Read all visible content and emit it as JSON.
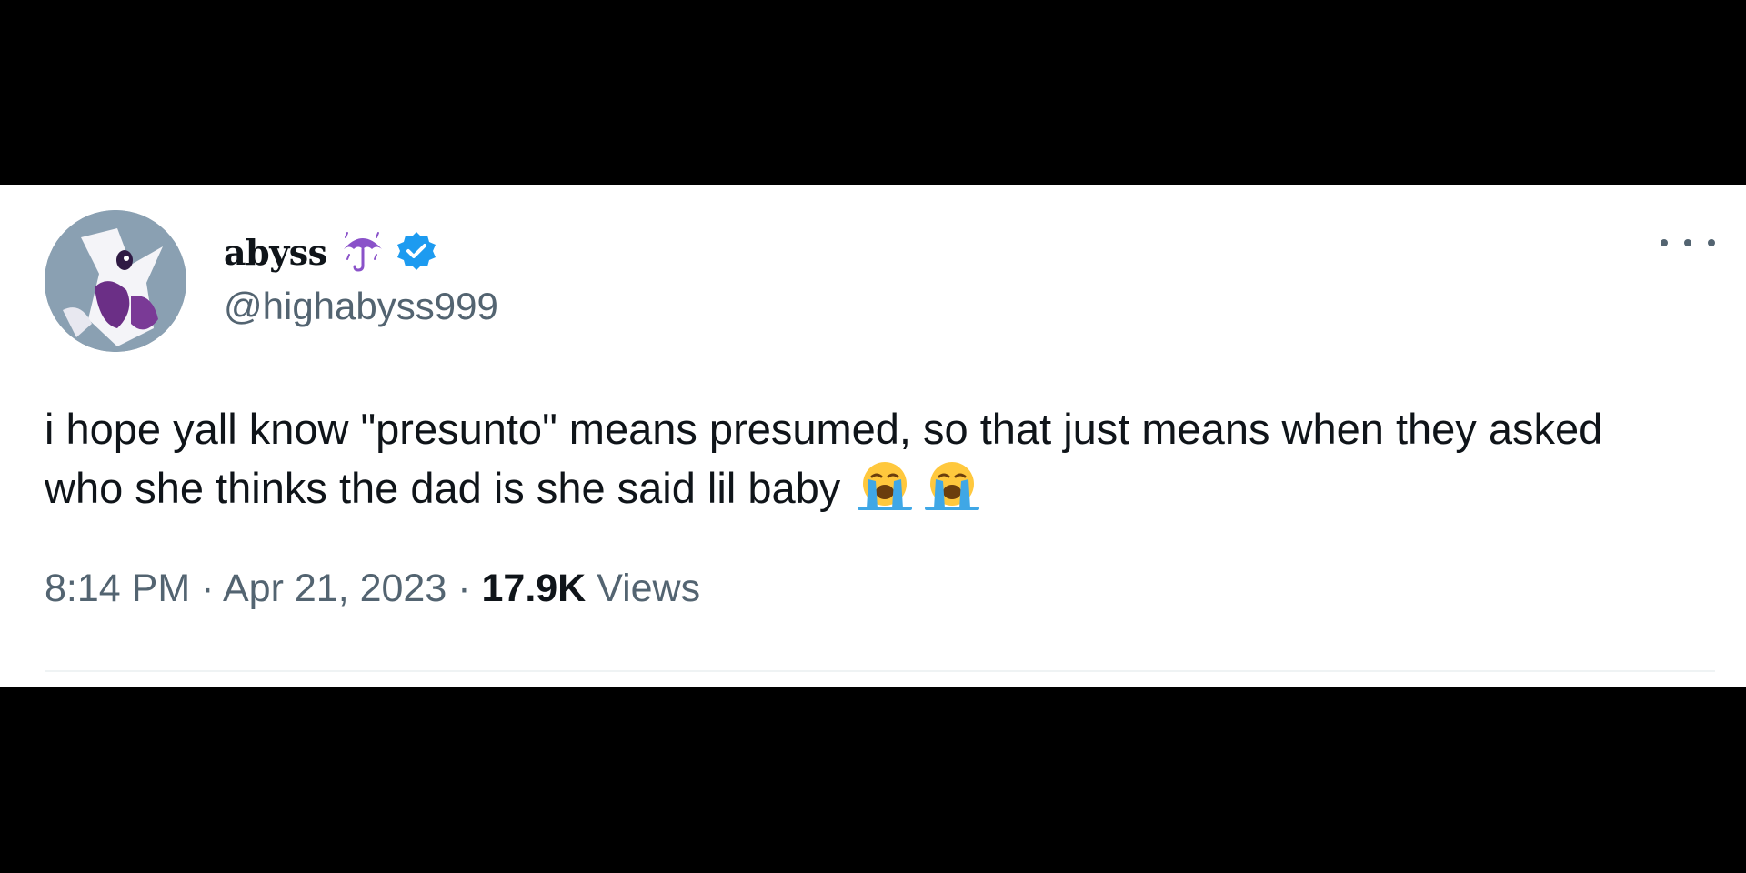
{
  "tweet": {
    "author": {
      "display_name": "abyss",
      "name_emoji": "umbrella-with-rain-icon",
      "verified": true,
      "verified_badge": "verified-badge-icon",
      "handle": "@highabyss999",
      "avatar": "avatar-character-image"
    },
    "more_menu": "more-options-icon",
    "text": "i hope yall know \"presunto\" means presumed, so that just means when they asked who she thinks the dad is she said lil baby",
    "emojis": [
      "loudly-crying-face-icon",
      "loudly-crying-face-icon"
    ],
    "time": "8:14 PM",
    "separator": "·",
    "date": "Apr 21, 2023",
    "views_count": "17.9K",
    "views_label": "Views"
  },
  "colors": {
    "background": "#000000",
    "card": "#ffffff",
    "text_primary": "#0f1419",
    "text_secondary": "#536471",
    "verified_blue": "#1d9bf0",
    "umbrella_purple": "#8a52c9",
    "emoji_yellow": "#ffc83d",
    "emoji_tears": "#3fa7e6"
  }
}
